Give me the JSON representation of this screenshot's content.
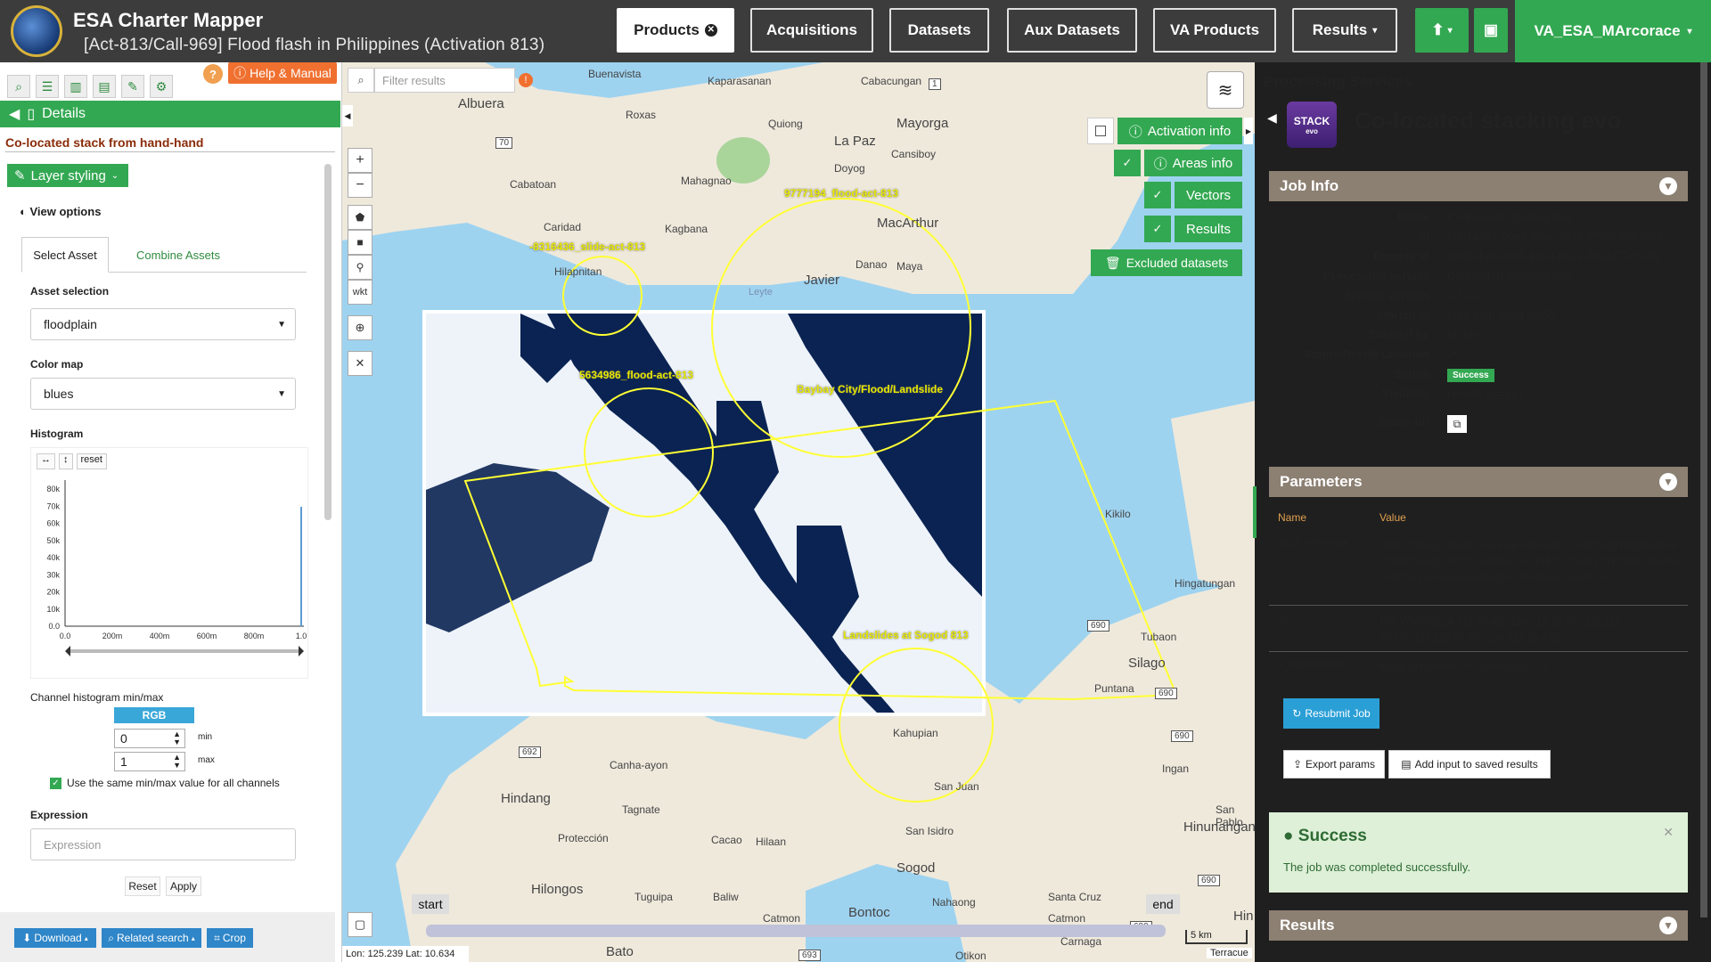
{
  "app": {
    "title": "ESA Charter Mapper",
    "subtitle": "[Act-813/Call-969] Flood flash in Philippines (Activation 813)",
    "user": "VA_ESA_MArcorace"
  },
  "nav": {
    "products": "Products",
    "acquisitions": "Acquisitions",
    "datasets": "Datasets",
    "aux_datasets": "Aux Datasets",
    "va_products": "VA Products",
    "results": "Results"
  },
  "left": {
    "help": "Help & Manual",
    "details": "Details",
    "stack_name": "Co-located stack from hand-hand",
    "layer_styling": "Layer styling",
    "view_options": "View options",
    "tab_select": "Select Asset",
    "tab_combine": "Combine Assets",
    "asset_selection_label": "Asset selection",
    "asset_selection_value": "floodplain",
    "color_map_label": "Color map",
    "color_map_value": "blues",
    "histogram_label": "Histogram",
    "hist_reset": "reset",
    "hist_y_ticks": [
      "80k",
      "70k",
      "60k",
      "50k",
      "40k",
      "30k",
      "20k",
      "10k",
      "0.0"
    ],
    "hist_x_ticks": [
      "0.0",
      "200m",
      "400m",
      "600m",
      "800m",
      "1.0"
    ],
    "chan_label": "Channel histogram min/max",
    "rgb": "RGB",
    "min_value": "0",
    "max_value": "1",
    "min_label": "min",
    "max_label": "max",
    "same_minmax": "Use the same min/max value for all channels",
    "expression_label": "Expression",
    "expression_placeholder": "Expression",
    "reset_btn": "Reset",
    "apply_btn": "Apply",
    "download": "Download",
    "related_search": "Related search",
    "crop": "Crop"
  },
  "map": {
    "filter_placeholder": "Filter results",
    "activation_info": "Activation info",
    "areas_info": "Areas info",
    "vectors": "Vectors",
    "results": "Results",
    "excluded": "Excluded datasets",
    "wkt": "wkt",
    "start": "start",
    "end": "end",
    "scale": "5 km",
    "coords": "Lon: 125.239 Lat: 10.634",
    "attribution": "Terracue",
    "places": [
      {
        "name": "Buenavista"
      },
      {
        "name": "Kaparasanan"
      },
      {
        "name": "Cabacungan"
      },
      {
        "name": "Albuera"
      },
      {
        "name": "Roxas"
      },
      {
        "name": "Quiong"
      },
      {
        "name": "La Paz"
      },
      {
        "name": "Mayorga"
      },
      {
        "name": "Cansiboy"
      },
      {
        "name": "Mahagnao"
      },
      {
        "name": "Doyog"
      },
      {
        "name": "Cabatoan"
      },
      {
        "name": "Caridad"
      },
      {
        "name": "Kagbana"
      },
      {
        "name": "MacArthur"
      },
      {
        "name": "Hilapnitan"
      },
      {
        "name": "Danao"
      },
      {
        "name": "Maya"
      },
      {
        "name": "Javier"
      },
      {
        "name": "Leyte"
      },
      {
        "name": "Kikilo"
      },
      {
        "name": "Hingatungan"
      },
      {
        "name": "Tubaon"
      },
      {
        "name": "Silago"
      },
      {
        "name": "Puntana"
      },
      {
        "name": "Kahupian"
      },
      {
        "name": "Canha-ayon"
      },
      {
        "name": "San Juan"
      },
      {
        "name": "Hindang"
      },
      {
        "name": "Tagnate"
      },
      {
        "name": "Ingan"
      },
      {
        "name": "San Pablo"
      },
      {
        "name": "Protección"
      },
      {
        "name": "Cacao"
      },
      {
        "name": "Hilaan"
      },
      {
        "name": "San Isidro"
      },
      {
        "name": "Hinunangan"
      },
      {
        "name": "Sogod"
      },
      {
        "name": "Hilongos"
      },
      {
        "name": "Tuguipa"
      },
      {
        "name": "Baliw"
      },
      {
        "name": "Nahaong"
      },
      {
        "name": "Santa Cruz"
      },
      {
        "name": "Catmon"
      },
      {
        "name": "Bontoc"
      },
      {
        "name": "Catmon"
      },
      {
        "name": "Carnaga"
      },
      {
        "name": "Bato"
      },
      {
        "name": "Otikon"
      },
      {
        "name": "Hin"
      }
    ],
    "road_numbers": [
      "70",
      "1",
      "692",
      "690",
      "690",
      "690",
      "693",
      "690",
      "690"
    ],
    "yellow_labels": [
      "-8316436_slide-act-813",
      "9777194_flood-act-813",
      "5634986_flood-act-813",
      "Baybay City/Flood/Landslide",
      "Landslides at Sogod 813"
    ]
  },
  "right": {
    "title": "Processing Services",
    "stack_icon_top": "STACK",
    "stack_icon_bottom": "evo",
    "service_name": "Co-located stacking evo",
    "job_info": "Job Info",
    "job": [
      {
        "k": "Name",
        "v": "Co-located stacking evo ✎"
      },
      {
        "k": "Id",
        "v": "c0044c34-99e6-49ae-bf47-9787c5db46a7"
      },
      {
        "k": "Remote Id",
        "v": "0586aba0-ef08-11ed-b612-6eaaf77cca89"
      },
      {
        "k": "Processing service",
        "v": "Co-located stacking evo"
      },
      {
        "k": "Service version",
        "v": "0.7.10"
      },
      {
        "k": "Started at",
        "v": "May 10th 2023 09:55"
      },
      {
        "k": "Created by",
        "v": "t2_test"
      },
      {
        "k": "Status/Result Location",
        "v": "↗"
      }
    ],
    "status_label": "Status",
    "status_value": "Success",
    "visibility_label": "Visibility",
    "visibility_value": "private",
    "share_link": "share",
    "share_url_label": "Share url",
    "parameters": "Parameters",
    "param_name": "Name",
    "param_value": "Value",
    "params": [
      {
        "k": "input_reference",
        "v": "https://catalog.charter.uat.esaportal.eu/t2_test/cat/dd7b32f66dbce2299439ea3a290c7b35de8407914341f57dea332417f93014eaf/search?format=atom&uid=dd7b32f6-hand-hand#hand"
      },
      {
        "k": "aoi",
        "v": "POLYGON((124.717 10.492,124.717 10.775,125.118 10.775,125.118 10.492,124.717 10.492))"
      },
      {
        "k": "s_expressions",
        "v": "floodplain:(where (<= 1.hand 20) 1 0)"
      }
    ],
    "resubmit": "Resubmit Job",
    "export_params": "Export params",
    "add_input": "Add input to saved results",
    "success_title": "Success",
    "success_msg": "The job was completed successfully.",
    "results": "Results"
  }
}
